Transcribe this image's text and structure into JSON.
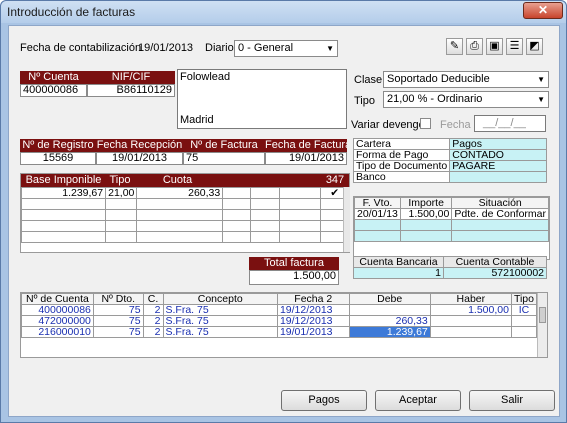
{
  "window": {
    "title": "Introducción de facturas",
    "close_glyph": "✕"
  },
  "header": {
    "fecha_label": "Fecha de contabilización",
    "fecha_value": "19/01/2013",
    "diario_label": "Diario",
    "diario_value": "0 - General"
  },
  "toolbar": {
    "icons": [
      "edit-icon",
      "print-icon",
      "box-icon",
      "card-icon",
      "preview-icon"
    ]
  },
  "cuenta": {
    "headers": [
      "Nº Cuenta",
      "NIF/CIF"
    ],
    "cuenta_value": "400000086",
    "nif_value": "B86110129",
    "address_line1": "Folowlead",
    "address_line2": "Madrid"
  },
  "clase": {
    "label": "Clase",
    "value": "Soportado Deducible"
  },
  "tipo": {
    "label": "Tipo",
    "value": "21,00 % - Ordinario"
  },
  "devengo": {
    "label": "Variar devengo",
    "fecha_label": "Fecha",
    "fecha_placeholder": "__/__/__"
  },
  "registro": {
    "headers": [
      "Nº de Registro",
      "Fecha Recepción",
      "Nº de Factura",
      "Fecha de Factura"
    ],
    "values": [
      "15569",
      "19/01/2013",
      "75",
      "19/01/2013"
    ]
  },
  "cartera": {
    "rows": [
      [
        "Cartera",
        "Pagos"
      ],
      [
        "Forma de Pago",
        "CONTADO"
      ],
      [
        "Tipo de Documento",
        "PAGARE"
      ],
      [
        "Banco",
        ""
      ]
    ]
  },
  "iva": {
    "headers": [
      "Base Imponible",
      "Tipo",
      "Cuota",
      "",
      "",
      "",
      "347"
    ],
    "row": [
      "1.239,67",
      "21,00",
      "260,33",
      "",
      "",
      "",
      "✔"
    ]
  },
  "vencimientos": {
    "headers": [
      "F. Vto.",
      "Importe",
      "Situación"
    ],
    "row": [
      "20/01/13",
      "1.500,00",
      "Pdte. de Conformar"
    ]
  },
  "total": {
    "label": "Total factura",
    "value": "1.500,00"
  },
  "cuenta_bancaria": {
    "headers": [
      "Cuenta Bancaria",
      "Cuenta Contable"
    ],
    "values": [
      "1",
      "572100002"
    ]
  },
  "apuntes": {
    "headers": [
      "Nº de Cuenta",
      "Nº Dto.",
      "C.",
      "Concepto",
      "Fecha 2",
      "Debe",
      "Haber",
      "Tipo"
    ],
    "rows": [
      [
        "400000086",
        "75",
        "2",
        "S.Fra. 75",
        "19/12/2013",
        "",
        "1.500,00",
        "IC"
      ],
      [
        "472000000",
        "75",
        "2",
        "S.Fra. 75",
        "19/12/2013",
        "260,33",
        "",
        ""
      ],
      [
        "216000010",
        "75",
        "2",
        "S.Fra. 75",
        "19/01/2013",
        "1.239,67",
        "",
        ""
      ]
    ]
  },
  "buttons": {
    "pagos": "Pagos",
    "aceptar": "Aceptar",
    "salir": "Salir"
  }
}
